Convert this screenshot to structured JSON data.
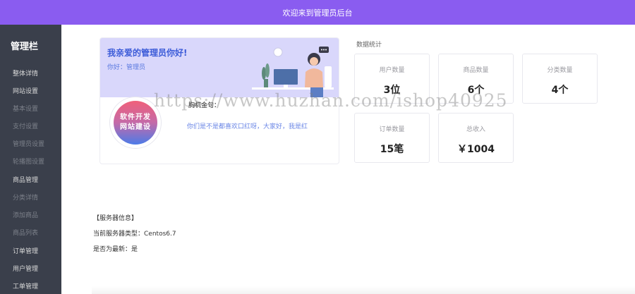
{
  "header": {
    "title": "欢迎来到管理员后台"
  },
  "sidebar": {
    "title": "管理栏",
    "items": [
      {
        "label": "整体详情"
      },
      {
        "label": "网站设置"
      },
      {
        "label": "基本设置"
      },
      {
        "label": "支付设置"
      },
      {
        "label": "管理员设置"
      },
      {
        "label": "轮播图设置"
      },
      {
        "label": "商品管理"
      },
      {
        "label": "分类详情"
      },
      {
        "label": "添加商品"
      },
      {
        "label": "商品列表"
      },
      {
        "label": "订单管理"
      },
      {
        "label": "用户管理"
      },
      {
        "label": "工单管理"
      }
    ]
  },
  "profile_card": {
    "greeting": "我亲爱的管理员你好!",
    "subtitle": "你好：管理员",
    "avatar_text_line1": "软件开发",
    "avatar_text_line2": "网站建设",
    "quote_label": "胸杌金句：",
    "quote": "你们是不是都喜欢口红呀，大家好，我是红"
  },
  "stats": {
    "title": "数据统计",
    "cards": [
      {
        "label": "用户数量",
        "value": "3位"
      },
      {
        "label": "商品数量",
        "value": "6个"
      },
      {
        "label": "分类数量",
        "value": "4个"
      },
      {
        "label": "订单数量",
        "value": "15笔"
      },
      {
        "label": "总收入",
        "value": "￥1004"
      }
    ]
  },
  "server": {
    "heading": "【服务器信息】",
    "type_label": "当前服务器类型：",
    "type_value": "Centos6.7",
    "latest_label": "是否为最新：",
    "latest_value": "是"
  },
  "watermark": "https://www.huzhan.com/ishop40925",
  "colors": {
    "header_bg": "#8a5cf0",
    "sidebar_bg": "#3a3f4b",
    "banner_bg": "#d9d7fb",
    "accent_text": "#3b5bd8"
  }
}
